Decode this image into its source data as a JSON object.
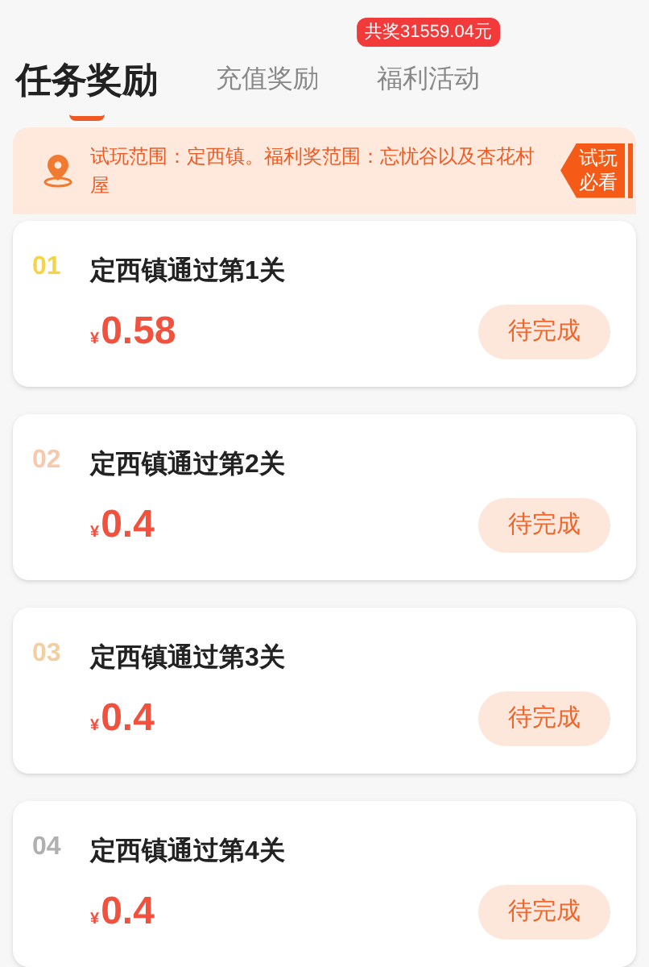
{
  "tabs": [
    {
      "label": "任务奖励",
      "selected": true
    },
    {
      "label": "充值奖励",
      "selected": false
    },
    {
      "label": "福利活动",
      "selected": false,
      "badge": "共奖31559.04元"
    }
  ],
  "notice": {
    "text": "试玩范围：定西镇。福利奖范围：忘忧谷以及杏花村屋",
    "tag": "试玩必看"
  },
  "tasks": [
    {
      "index": "01",
      "color": "#f5d547",
      "title": "定西镇通过第1关",
      "currency": "¥",
      "amount": "0.58",
      "status": "待完成"
    },
    {
      "index": "02",
      "color": "#f8c8ac",
      "title": "定西镇通过第2关",
      "currency": "¥",
      "amount": "0.4",
      "status": "待完成"
    },
    {
      "index": "03",
      "color": "#f3cfa0",
      "title": "定西镇通过第3关",
      "currency": "¥",
      "amount": "0.4",
      "status": "待完成"
    },
    {
      "index": "04",
      "color": "#b0b0b0",
      "title": "定西镇通过第4关",
      "currency": "¥",
      "amount": "0.4",
      "status": "待完成"
    }
  ]
}
